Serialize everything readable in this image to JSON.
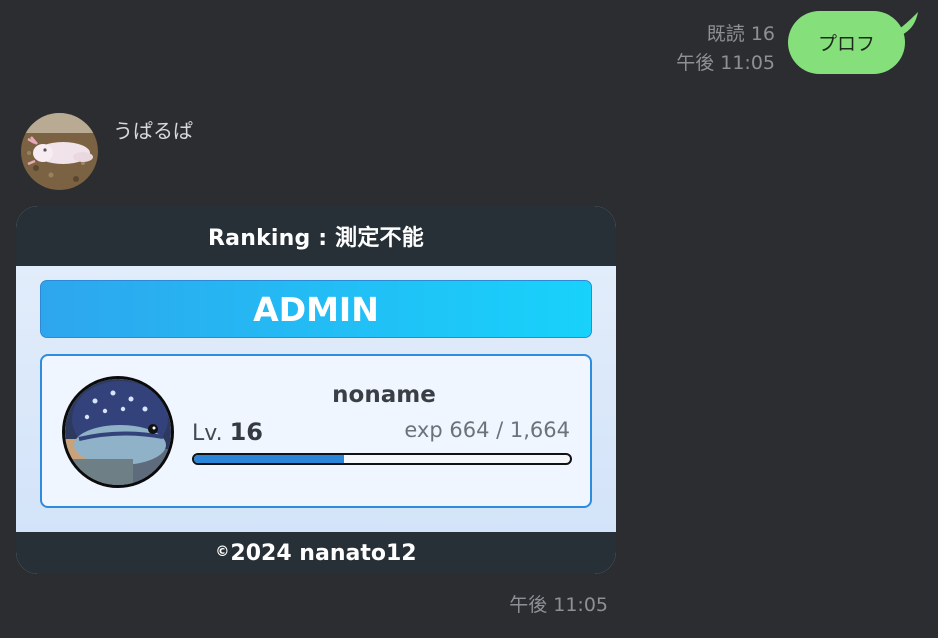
{
  "outgoing": {
    "read_status": "既読 16",
    "time": "午後 11:05",
    "text": "プロフ"
  },
  "incoming": {
    "sender_name": "うぱるぱ",
    "time": "午後 11:05",
    "card": {
      "header": "Ranking : 測定不能",
      "role": "ADMIN",
      "profile": {
        "name": "noname",
        "level_label": "Lv.",
        "level_value": "16",
        "exp_text": "exp 664 / 1,664",
        "exp_current": 664,
        "exp_max": 1664
      },
      "footer_symbol": "©",
      "footer_text": "2024 nanato12"
    }
  },
  "colors": {
    "background": "#2b2d30",
    "outgoing_bubble": "#85e07c",
    "card_dark": "#263036",
    "admin_gradient_start": "#2ea6ee",
    "admin_gradient_end": "#18d2fb",
    "exp_fill": "#2a84d8"
  }
}
